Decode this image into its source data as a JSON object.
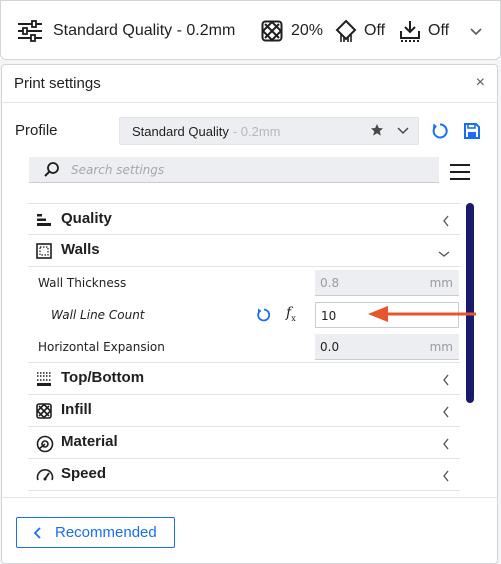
{
  "topbar": {
    "profile": {
      "icon": "sliders-icon",
      "label": "Standard Quality - 0.2mm"
    },
    "infill": {
      "icon": "infill-icon",
      "value": "20%"
    },
    "support": {
      "icon": "support-icon",
      "value": "Off"
    },
    "adhesion": {
      "icon": "adhesion-icon",
      "value": "Off"
    },
    "expand_icon": "chevron-down-icon"
  },
  "panel": {
    "title": "Print settings",
    "close_label": "×",
    "profile": {
      "label": "Profile",
      "selected_name": "Standard Quality",
      "selected_suffix": "- 0.2mm"
    },
    "search": {
      "placeholder": "Search settings",
      "value": ""
    },
    "categories": [
      {
        "label": "Quality",
        "icon": "quality-icon",
        "expanded": false
      },
      {
        "label": "Walls",
        "icon": "walls-icon",
        "expanded": true
      },
      {
        "label": "Top/Bottom",
        "icon": "top-bottom-icon",
        "expanded": false
      },
      {
        "label": "Infill",
        "icon": "infill-icon",
        "expanded": false
      },
      {
        "label": "Material",
        "icon": "material-icon",
        "expanded": false
      },
      {
        "label": "Speed",
        "icon": "speed-icon",
        "expanded": false
      }
    ],
    "walls_settings": [
      {
        "label": "Wall Thickness",
        "value": "0.8",
        "unit": "mm",
        "disabled": true
      },
      {
        "label": "Wall Line Count",
        "value": "10",
        "unit": "",
        "active": true
      },
      {
        "label": "Horizontal Expansion",
        "value": "0.0",
        "unit": "mm"
      }
    ],
    "fx_label": "f",
    "fx_sub": "x",
    "recommended_button": "Recommended"
  },
  "colors": {
    "accent": "#196ef0",
    "scrollbar": "#1a1a6c",
    "annotation_arrow": "#e8542c"
  }
}
